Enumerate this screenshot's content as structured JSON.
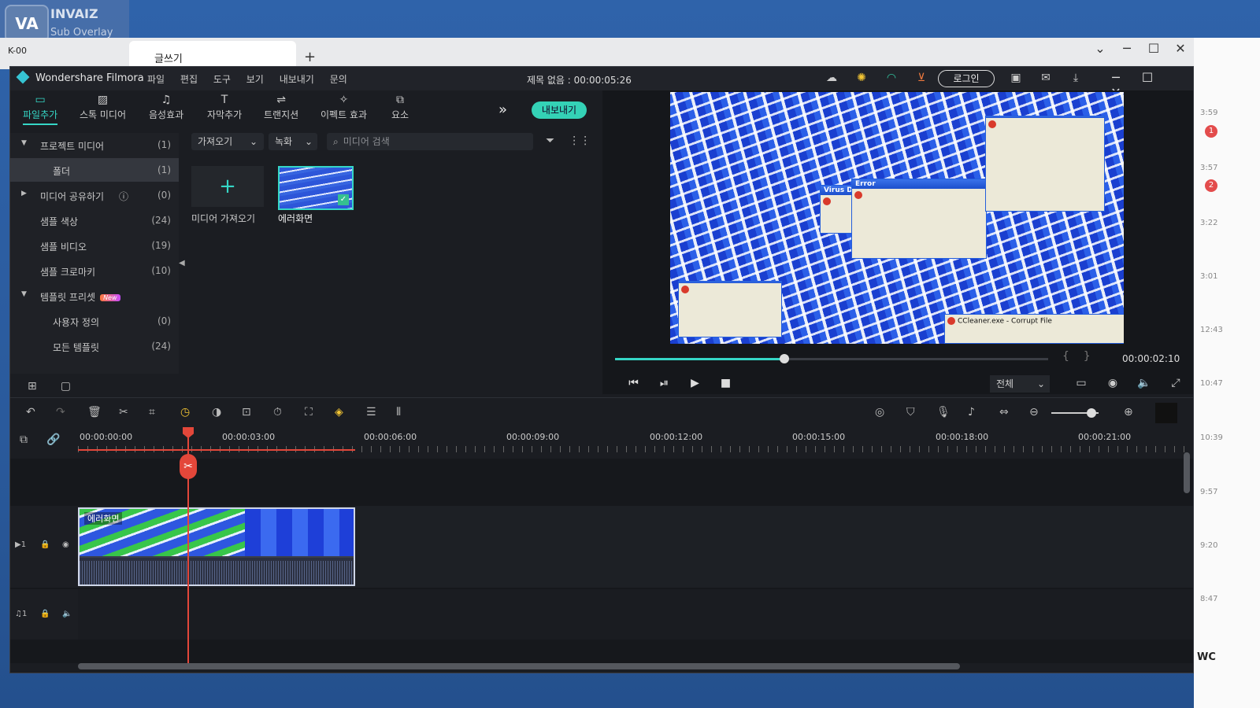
{
  "desktop": {
    "overlay_app": {
      "logo": "VA",
      "name": "INVAIZ",
      "subtitle": "Sub Overlay"
    },
    "taskbar_label": "K-00",
    "browser_tab": "글쓰기",
    "browser_new_tab": "+",
    "side_panel": {
      "times": [
        "3:59",
        "3:57",
        "3:22",
        "3:01",
        "12:43",
        "10:47",
        "10:39",
        "9:57",
        "9:20",
        "8:47"
      ],
      "badges": [
        "1",
        "2"
      ],
      "footer_text": "WC"
    }
  },
  "app": {
    "brand": "Wondershare Filmora",
    "menu": [
      "파일",
      "편집",
      "도구",
      "보기",
      "내보내기",
      "문의"
    ],
    "title": "제목 없음 : 00:00:05:26",
    "login_label": "로그인",
    "export_label": "내보내기",
    "tabs": [
      {
        "label": "파일추가",
        "icon": "folder-icon",
        "active": true
      },
      {
        "label": "스톡 미디어",
        "icon": "image-icon",
        "active": false
      },
      {
        "label": "음성효과",
        "icon": "music-note-icon",
        "active": false
      },
      {
        "label": "자막추가",
        "icon": "text-icon",
        "active": false
      },
      {
        "label": "트랜지션",
        "icon": "transition-icon",
        "active": false
      },
      {
        "label": "이펙트 효과",
        "icon": "effects-icon",
        "active": false
      },
      {
        "label": "요소",
        "icon": "elements-icon",
        "active": false
      }
    ],
    "tree": [
      {
        "label": "프로젝트 미디어",
        "count": "(1)",
        "expander": "down"
      },
      {
        "label": "폴더",
        "count": "(1)",
        "selected": true
      },
      {
        "label": "미디어 공유하기",
        "count": "(0)",
        "expander": "right",
        "info": true
      },
      {
        "label": "샘플 색상",
        "count": "(24)"
      },
      {
        "label": "샘플 비디오",
        "count": "(19)"
      },
      {
        "label": "샘플 크로마키",
        "count": "(10)"
      },
      {
        "label": "템플릿 프리셋",
        "count": "",
        "expander": "down",
        "badge": "New"
      },
      {
        "label": "사용자 정의",
        "count": "(0)"
      },
      {
        "label": "모든 템플릿",
        "count": "(24)"
      }
    ],
    "media": {
      "import_dropdown": "가져오기",
      "record_dropdown": "녹화",
      "search_placeholder": "미디어 검색",
      "import_tile_label": "미디어 가져오기",
      "clip_label": "에러화면"
    },
    "preview": {
      "progress": 0.39,
      "timecode": "00:00:02:10",
      "quality": "전체",
      "error_dialog_title": "Error",
      "virus_dialog_title": "Virus Detected",
      "ccleaner_text": "CCleaner.exe - Corrupt File"
    },
    "timeline": {
      "ruler_labels": [
        "00:00:00:00",
        "00:00:03:00",
        "00:00:06:00",
        "00:00:09:00",
        "00:00:12:00",
        "00:00:15:00",
        "00:00:18:00",
        "00:00:21:00"
      ],
      "clip_label": "에러화면",
      "video_track": "1",
      "audio_track": "1",
      "zoom_level": 0.85
    }
  }
}
